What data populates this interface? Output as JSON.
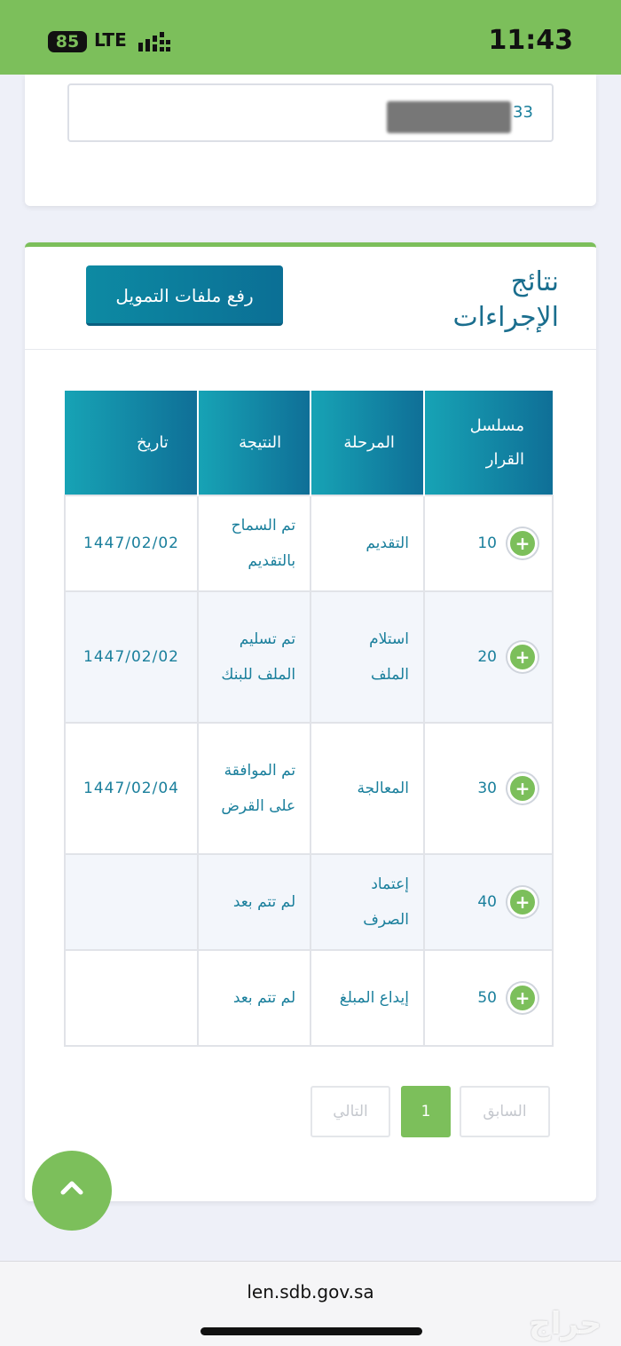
{
  "status_bar": {
    "battery": "85",
    "network": "LTE",
    "time": "11:43"
  },
  "id_field": {
    "value_suffix": "33"
  },
  "results": {
    "title": "نتائج الإجراءات",
    "upload_button": "رفع ملفات التمويل",
    "columns": [
      "مسلسل القرار",
      "المرحلة",
      "النتيجة",
      "تاريخ"
    ],
    "rows": [
      {
        "serial": "10",
        "stage": "التقديم",
        "result": "تم السماح بالتقديم",
        "date": "1447/02/02"
      },
      {
        "serial": "20",
        "stage": "استلام الملف",
        "result": "تم تسليم الملف للبنك",
        "date": "1447/02/02"
      },
      {
        "serial": "30",
        "stage": "المعالجة",
        "result": "تم الموافقة على القرض",
        "date": "1447/02/04"
      },
      {
        "serial": "40",
        "stage": "إعتماد الصرف",
        "result": "لم تتم بعد",
        "date": ""
      },
      {
        "serial": "50",
        "stage": "إيداع المبلغ",
        "result": "لم تتم بعد",
        "date": ""
      }
    ]
  },
  "pagination": {
    "previous": "السابق",
    "current": "1",
    "next": "التالي"
  },
  "browser": {
    "url": "len.sdb.gov.sa"
  },
  "watermark": "حراج",
  "colors": {
    "accent_green": "#7cbf5b",
    "header_teal": "#0f6f97",
    "text_teal": "#1a7f9c"
  }
}
